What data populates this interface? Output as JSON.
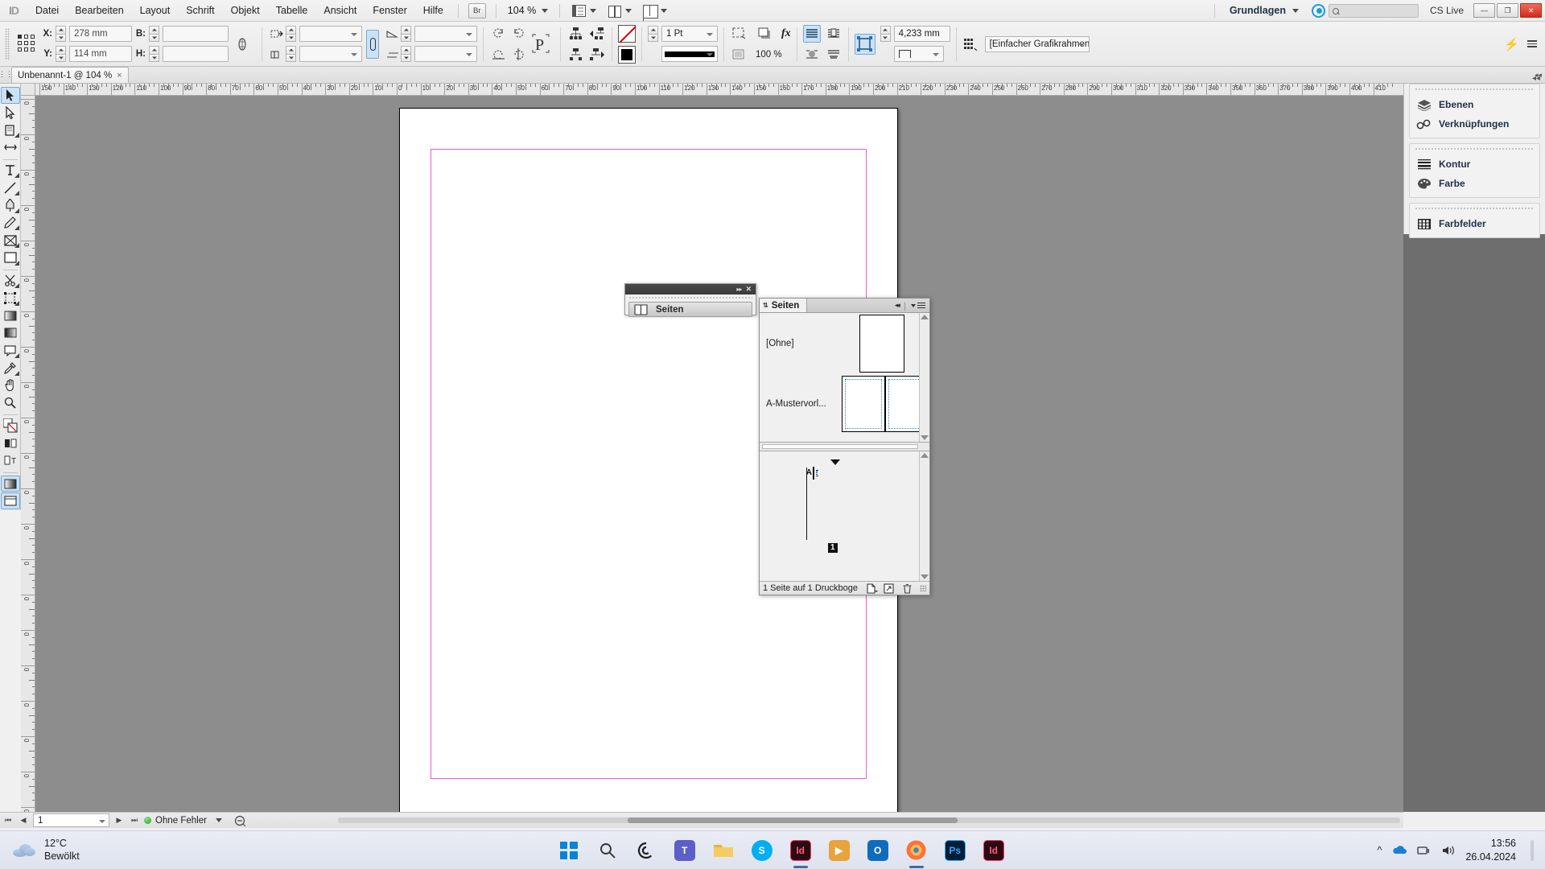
{
  "app": {
    "name": "Adobe InDesign",
    "logo_text": "ID"
  },
  "menubar": {
    "items": [
      "Datei",
      "Bearbeiten",
      "Layout",
      "Schrift",
      "Objekt",
      "Tabelle",
      "Ansicht",
      "Fenster",
      "Hilfe"
    ],
    "bridge_badge": "Br",
    "zoom_level": "104 %",
    "workspace": "Grundlagen",
    "cs_live": "CS Live",
    "search_placeholder": "",
    "window_buttons": {
      "minimize": "—",
      "maximize": "❐",
      "close": "✕"
    }
  },
  "control_panel": {
    "x_label": "X:",
    "x_value": "278 mm",
    "y_label": "Y:",
    "y_value": "114 mm",
    "w_label": "B:",
    "w_value": "",
    "h_label": "H:",
    "h_value": "",
    "scale_x_value": "",
    "scale_y_value": "",
    "rotation_value": "",
    "shear_value": "",
    "stroke_weight": "1 Pt",
    "stroke_type": "",
    "opacity": "100 %",
    "corner_radius": "4,233 mm",
    "object_style": "[Einfacher Grafikrahmen]",
    "fx_label": "fx",
    "p_label": "P"
  },
  "document_tab": {
    "title": "Unbenannt-1 @ 104 %",
    "close_glyph": "×"
  },
  "rulers": {
    "unit": "mm",
    "h_labels": [
      "150",
      "140",
      "130",
      "120",
      "110",
      "100",
      "90",
      "80",
      "70",
      "60",
      "50",
      "40",
      "30",
      "20",
      "10",
      "0",
      "10",
      "20",
      "30",
      "40",
      "50",
      "60",
      "70",
      "80",
      "90",
      "100",
      "110",
      "120",
      "130",
      "140",
      "150",
      "160",
      "170",
      "180",
      "190",
      "200",
      "210",
      "220",
      "230",
      "240",
      "250",
      "260",
      "270",
      "280",
      "290",
      "300",
      "310",
      "320",
      "330",
      "340",
      "350",
      "360",
      "370",
      "380",
      "390",
      "400",
      "410"
    ],
    "v_labels": [
      "0",
      "0",
      "0",
      "0",
      "0",
      "0",
      "0",
      "0",
      "0",
      "0",
      "0",
      "0",
      "0",
      "0",
      "0",
      "0",
      "0",
      "0",
      "0",
      "0"
    ]
  },
  "toolbox": {
    "tools": [
      {
        "name": "selection-tool",
        "label": "Auswahl"
      },
      {
        "name": "direct-selection-tool",
        "label": "Direktauswahl"
      },
      {
        "name": "page-tool",
        "label": "Seite"
      },
      {
        "name": "gap-tool",
        "label": "Abstand"
      },
      {
        "name": "type-tool",
        "label": "Text"
      },
      {
        "name": "line-tool",
        "label": "Linie"
      },
      {
        "name": "pen-tool",
        "label": "Zeichenstift"
      },
      {
        "name": "pencil-tool",
        "label": "Buntstift"
      },
      {
        "name": "frame-tool",
        "label": "Rahmen"
      },
      {
        "name": "rectangle-tool",
        "label": "Rechteck"
      },
      {
        "name": "scissors-tool",
        "label": "Schere"
      },
      {
        "name": "free-transform-tool",
        "label": "Frei transformieren"
      },
      {
        "name": "gradient-swatch-tool",
        "label": "Verlauf"
      },
      {
        "name": "gradient-feather-tool",
        "label": "Verlaufsweichzeichner"
      },
      {
        "name": "note-tool",
        "label": "Notiz"
      },
      {
        "name": "eyedropper-tool",
        "label": "Pipette"
      },
      {
        "name": "hand-tool",
        "label": "Hand"
      },
      {
        "name": "zoom-tool",
        "label": "Zoom"
      }
    ]
  },
  "right_dock": {
    "groups": [
      {
        "items": [
          {
            "label": "Ebenen",
            "icon": "layers-icon"
          },
          {
            "label": "Verknüpfungen",
            "icon": "links-icon"
          }
        ]
      },
      {
        "items": [
          {
            "label": "Kontur",
            "icon": "stroke-icon"
          },
          {
            "label": "Farbe",
            "icon": "color-icon"
          }
        ]
      },
      {
        "items": [
          {
            "label": "Farbfelder",
            "icon": "swatches-icon"
          }
        ]
      }
    ]
  },
  "float_panel": {
    "tab_label": "Seiten",
    "icon": "pages-icon",
    "collapse_glyph": "▸▸",
    "close_glyph": "✕"
  },
  "pages_panel": {
    "tab_label": "Seiten",
    "sort_glyph": "⇅",
    "collapse_glyph": "◂◂",
    "masters": [
      {
        "name": "[Ohne]",
        "type": "single"
      },
      {
        "name": "A-Mustervorl...",
        "type": "spread"
      }
    ],
    "pages": [
      {
        "number": "1",
        "master": "A",
        "selected": true
      }
    ],
    "footer_text": "1 Seite auf 1 Druckboge",
    "footer_buttons": [
      {
        "name": "new-page-button",
        "icon": "new-page-icon"
      },
      {
        "name": "create-spread-button",
        "icon": "spread-icon"
      },
      {
        "name": "delete-page-button",
        "icon": "trash-icon"
      }
    ]
  },
  "status_bar": {
    "page_number": "1",
    "preflight_status": "Ohne Fehler",
    "first_glyph": "⏮",
    "prev_glyph": "◀",
    "next_glyph": "▶",
    "last_glyph": "⏭"
  },
  "taskbar": {
    "weather_temp": "12°C",
    "weather_desc": "Bewölkt",
    "clock_time": "13:56",
    "clock_date": "26.04.2024",
    "apps": [
      {
        "name": "start-button",
        "label": "",
        "color": "#0a82d8"
      },
      {
        "name": "search-button",
        "label": "",
        "color": "#555555"
      },
      {
        "name": "copilot-button",
        "label": "",
        "color": "#1d1d1d"
      },
      {
        "name": "teams-button",
        "label": "T",
        "color": "#5b5fc7"
      },
      {
        "name": "explorer-button",
        "label": "",
        "color": "#e8b23a"
      },
      {
        "name": "skype-button",
        "label": "S",
        "color": "#00aff0"
      },
      {
        "name": "indesign-button",
        "label": "Id",
        "color": "#ff3366"
      },
      {
        "name": "media-player-button",
        "label": "▶",
        "color": "#e8a33d"
      },
      {
        "name": "outlook-button",
        "label": "O",
        "color": "#0f6cbd"
      },
      {
        "name": "firefox-button",
        "label": "",
        "color": "#ff7139"
      },
      {
        "name": "photoshop-button",
        "label": "Ps",
        "color": "#31a8ff"
      },
      {
        "name": "indesign2-button",
        "label": "Id",
        "color": "#ff3366"
      }
    ]
  }
}
